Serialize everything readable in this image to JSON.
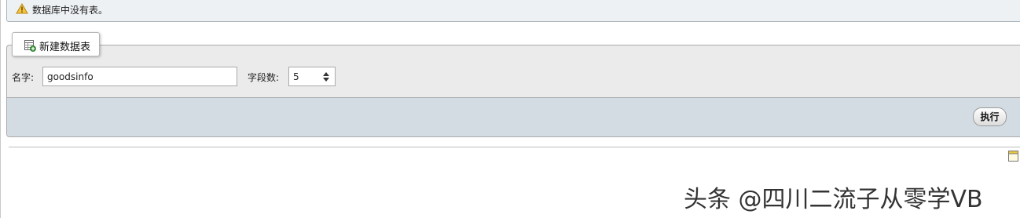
{
  "notice": {
    "icon": "warning-icon",
    "text": "数据库中没有表。"
  },
  "create_table": {
    "legend_icon": "new-table-icon",
    "legend_label": "新建数据表",
    "name_label": "名字:",
    "name_value": "goodsinfo",
    "columns_label": "字段数:",
    "columns_value": "5",
    "go_label": "执行"
  },
  "watermark": "头条 @四川二流子从零学VB",
  "colors": {
    "notice_bg": "#eef1f4",
    "fieldset_bg": "#ebebeb",
    "footer_bg": "#d3dce3"
  }
}
